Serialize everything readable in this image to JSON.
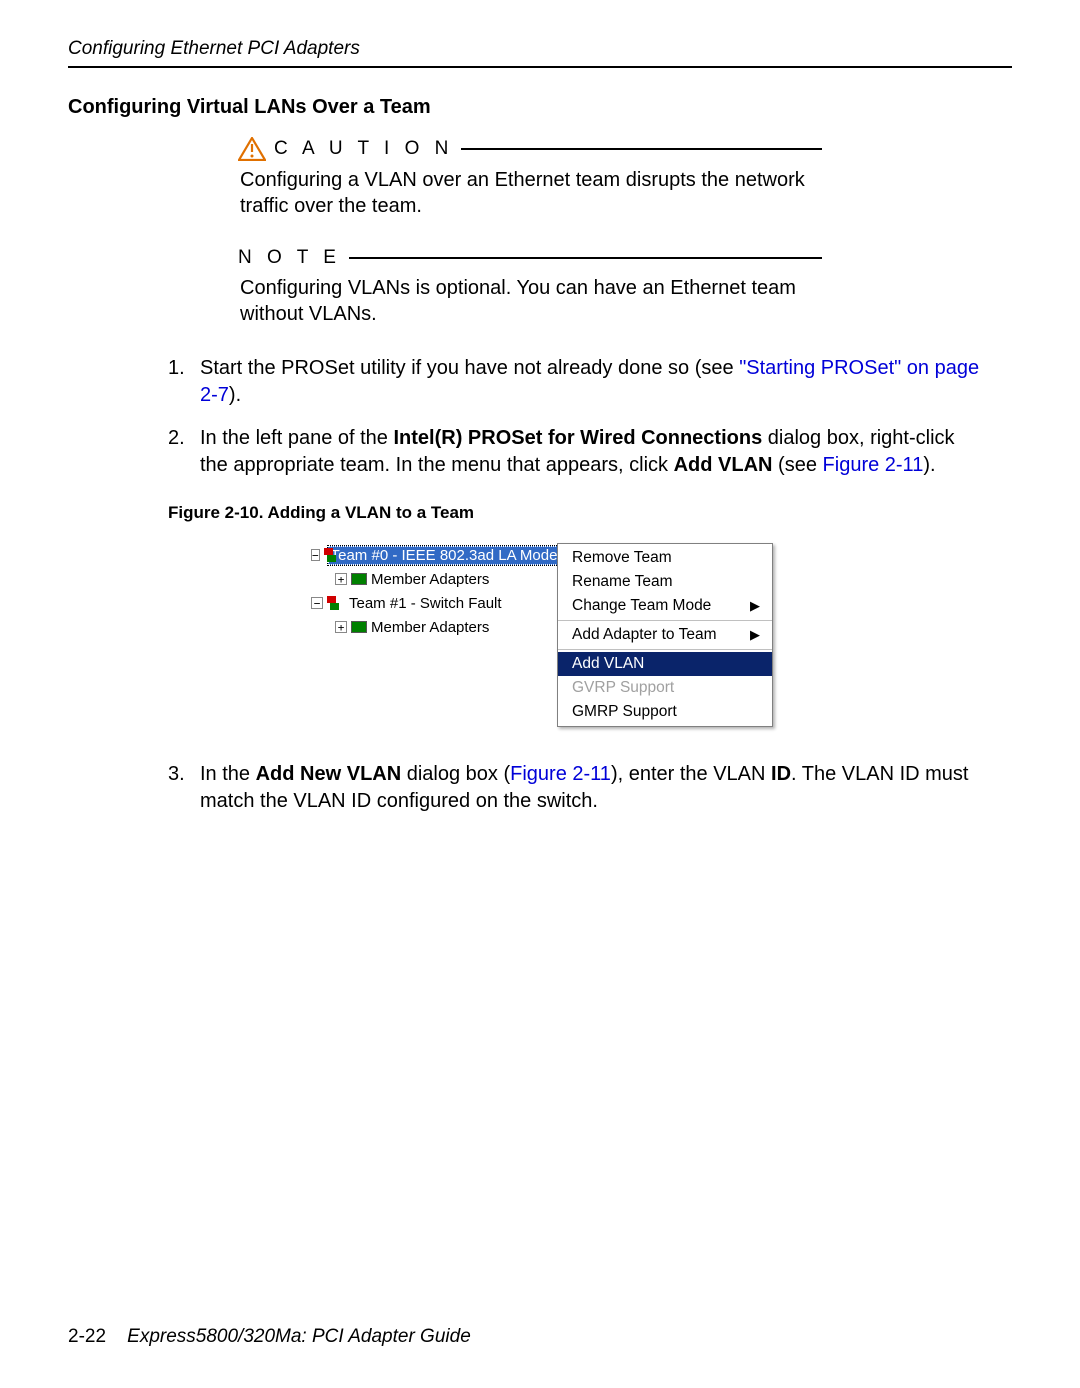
{
  "header": {
    "title": "Configuring Ethernet PCI Adapters"
  },
  "section": {
    "heading": "Configuring Virtual LANs Over a Team"
  },
  "caution": {
    "label": "C A U T I O N",
    "body": "Configuring a VLAN over an Ethernet team disrupts the network traffic over the team."
  },
  "note": {
    "label": "N O T E",
    "body": "Configuring VLANs is optional. You can have an Ethernet team without VLANs."
  },
  "steps": {
    "s1": {
      "num": "1.",
      "pre": "Start the PROSet utility if you have not already done so (see ",
      "link": "\"Starting PROSet\" on page 2-7",
      "post": ")."
    },
    "s2": {
      "num": "2.",
      "t1": "In the left pane of the ",
      "bold1": "Intel(R) PROSet for Wired Connections",
      "t2": " dialog box, right-click the appropriate team. In the menu that appears, click ",
      "bold2": "Add VLAN",
      "t3": " (see ",
      "link": "Figure 2-11",
      "t4": ")."
    },
    "s3": {
      "num": "3.",
      "t1": "In the ",
      "bold1": "Add New VLAN",
      "t2": " dialog box (",
      "link": "Figure 2-11",
      "t3": "), enter the VLAN ",
      "bold2": "ID",
      "t4": ". The VLAN ID must match the VLAN ID configured on the switch."
    }
  },
  "figure": {
    "caption": "Figure 2-10. Adding a VLAN to a Team",
    "tree": {
      "team0": "Team #0 - IEEE 802.3ad LA Mode",
      "members0": "Member Adapters",
      "team1": "Team #1 - Switch Fault",
      "members1": "Member Adapters"
    },
    "menu": {
      "remove": "Remove Team",
      "rename": "Rename Team",
      "changeMode": "Change Team Mode",
      "addAdapter": "Add Adapter to Team",
      "addVlan": "Add VLAN",
      "gvrp": "GVRP Support",
      "gmrp": "GMRP Support"
    }
  },
  "footer": {
    "page": "2-22",
    "title": "Express5800/320Ma: PCI Adapter Guide"
  }
}
